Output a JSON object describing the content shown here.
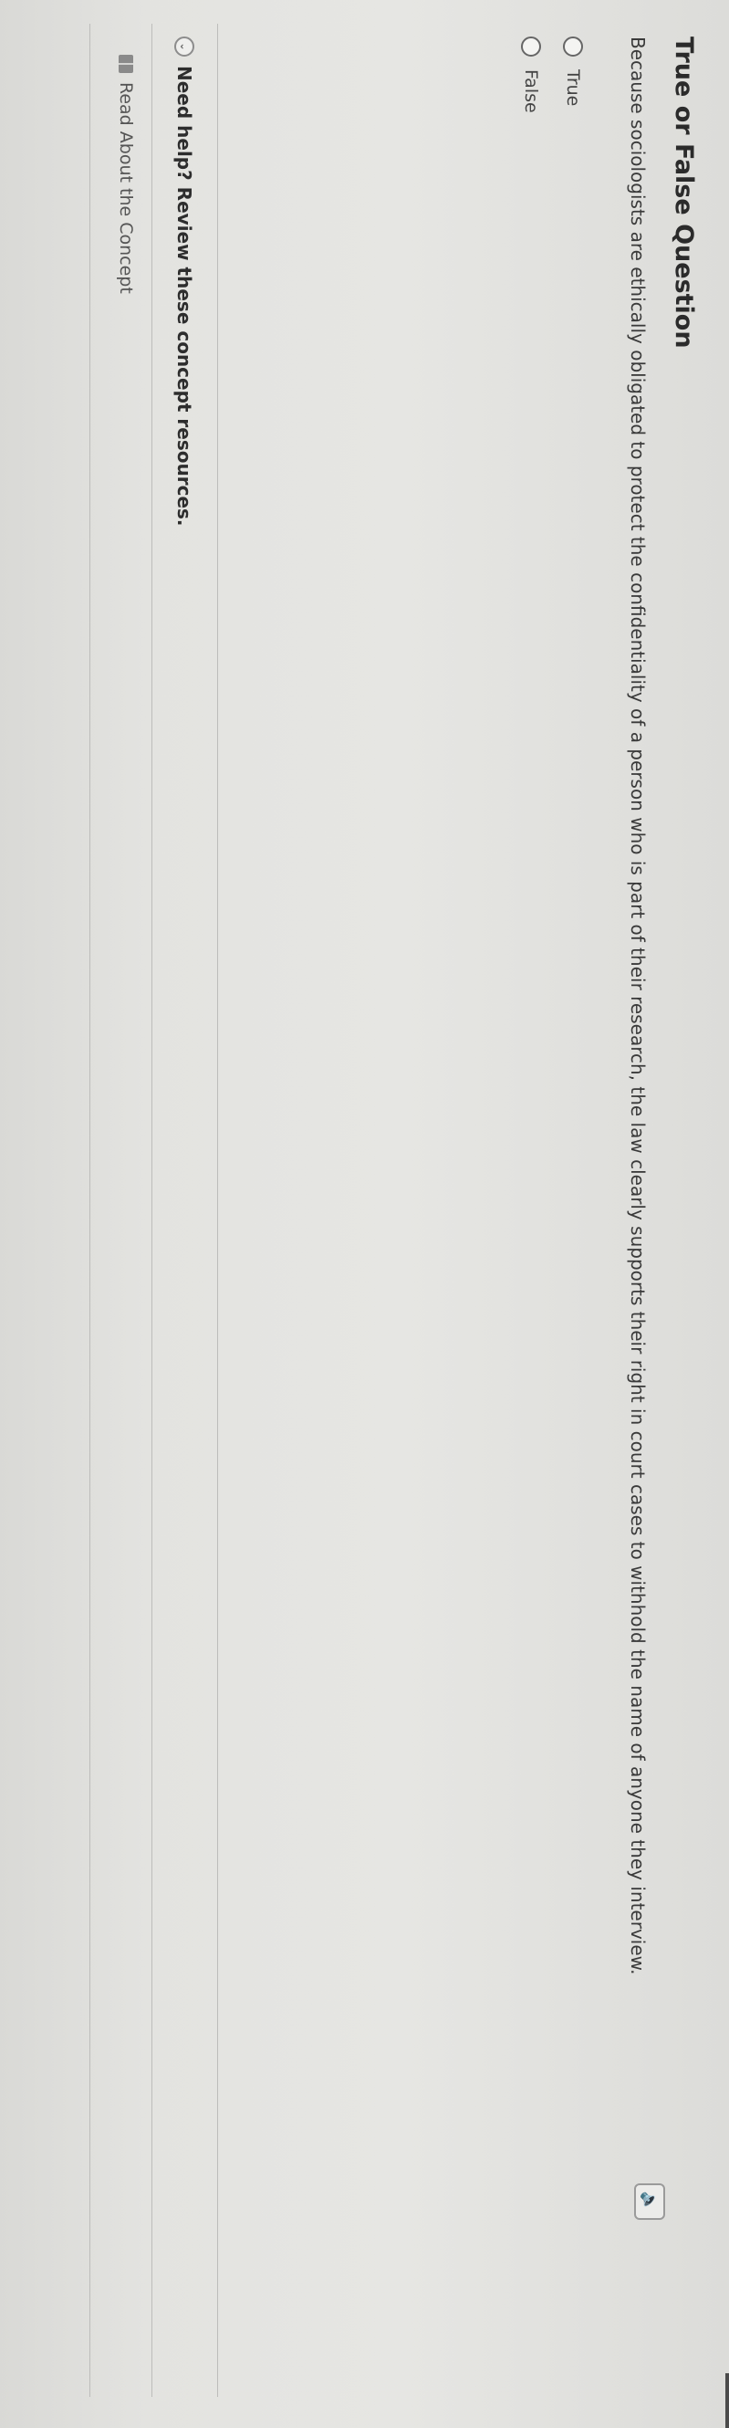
{
  "question": {
    "title": "True or False Question",
    "text": "Because sociologists are ethically obligated to protect the confidentiality of a person who is part of their research, the law clearly supports their right in court cases to withhold the name of anyone they interview.",
    "audio_icon": "speaker-icon"
  },
  "options": [
    {
      "label": "True"
    },
    {
      "label": "False"
    }
  ],
  "help": {
    "label": "Need help? Review these concept resources.",
    "icon": "chevron-icon"
  },
  "resources": [
    {
      "label": "Read About the Concept",
      "icon": "book-icon"
    }
  ]
}
